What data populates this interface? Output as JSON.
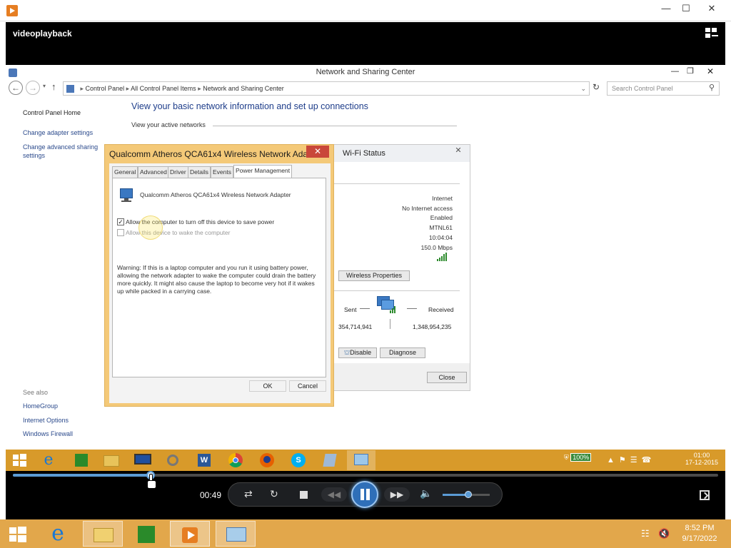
{
  "player": {
    "video_title": "videoplayback",
    "time_elapsed": "00:49",
    "seek_progress_percent": 19.5,
    "volume_percent": 55
  },
  "control_panel": {
    "window_title": "Network and Sharing Center",
    "breadcrumb": [
      "Control Panel",
      "All Control Panel Items",
      "Network and Sharing Center"
    ],
    "search_placeholder": "Search Control Panel",
    "sidebar": {
      "home": "Control Panel Home",
      "links": [
        "Change adapter settings",
        "Change advanced sharing settings"
      ],
      "see_also_label": "See also",
      "see_also": [
        "HomeGroup",
        "Internet Options",
        "Windows Firewall"
      ]
    },
    "heading": "View your basic network information and set up connections",
    "active_networks": "View your active networks"
  },
  "wifi_status": {
    "title": "Wi-Fi Status",
    "values": [
      "Internet",
      "No Internet access",
      "Enabled",
      "MTNL61",
      "10:04:04",
      "150.0 Mbps"
    ],
    "wireless_properties_label": "Wireless Properties",
    "sent_label": "Sent",
    "received_label": "Received",
    "sent_value": "354,714,941",
    "received_value": "1,348,954,235",
    "disable_label": "Disable",
    "diagnose_label": "Diagnose",
    "close_label": "Close"
  },
  "adapter_properties": {
    "title": "Qualcomm Atheros QCA61x4 Wireless Network Ada...",
    "tabs": [
      "General",
      "Advanced",
      "Driver",
      "Details",
      "Events",
      "Power Management"
    ],
    "active_tab": "Power Management",
    "device_name": "Qualcomm Atheros QCA61x4 Wireless Network Adapter",
    "option_allow_turn_off": "Allow the computer to turn off this device to save power",
    "option_allow_turn_off_checked": true,
    "option_allow_wake": "Allow this device to wake the computer",
    "option_allow_wake_checked": false,
    "warning": "Warning: If this is a laptop computer and you run it using battery power, allowing the network adapter to wake the computer could drain the battery more quickly. It might also cause the laptop to become very hot if it wakes up while packed in a carrying case.",
    "ok_label": "OK",
    "cancel_label": "Cancel"
  },
  "recorded_taskbar": {
    "battery": "100%",
    "time": "01:00",
    "date": "17-12-2015"
  },
  "taskbar": {
    "time": "8:52 PM",
    "date": "9/17/2022"
  }
}
